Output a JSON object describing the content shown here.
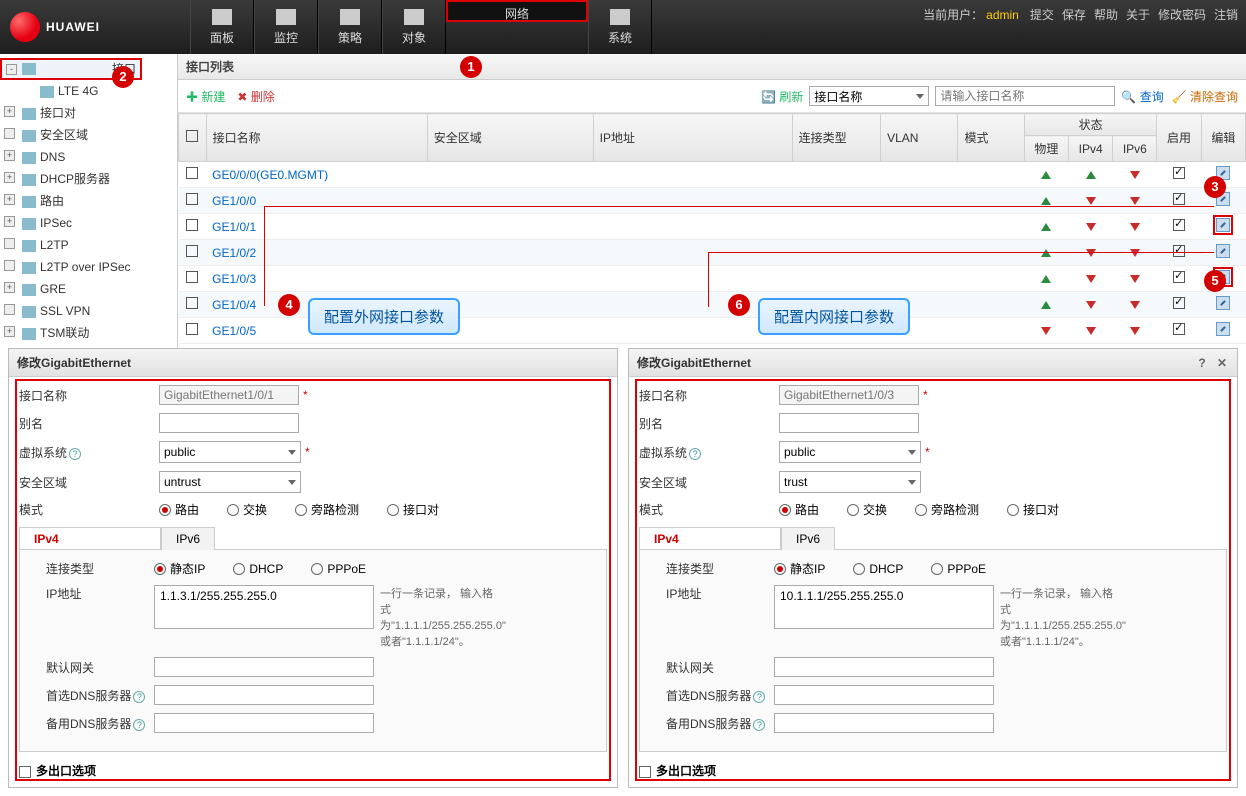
{
  "topnav": {
    "tabs": [
      "面板",
      "监控",
      "策略",
      "对象",
      "网络",
      "系统"
    ],
    "selected": 4,
    "user_label": "当前用户：",
    "user": "admin",
    "links": [
      "提交",
      "保存",
      "帮助",
      "关于",
      "修改密码",
      "注销"
    ]
  },
  "tree": {
    "items": [
      {
        "label": "接口",
        "expand": "-",
        "sel": true
      },
      {
        "label": "LTE 4G",
        "child": true
      },
      {
        "label": "接口对",
        "expand": "+"
      },
      {
        "label": "安全区域",
        "expand": ""
      },
      {
        "label": "DNS",
        "expand": "+"
      },
      {
        "label": "DHCP服务器",
        "expand": "+"
      },
      {
        "label": "路由",
        "expand": "+"
      },
      {
        "label": "IPSec",
        "expand": "+"
      },
      {
        "label": "L2TP",
        "expand": ""
      },
      {
        "label": "L2TP over IPSec",
        "expand": ""
      },
      {
        "label": "GRE",
        "expand": "+"
      },
      {
        "label": "SSL VPN",
        "expand": ""
      },
      {
        "label": "TSM联动",
        "expand": "+"
      }
    ]
  },
  "iface": {
    "title": "接口列表",
    "btn_new": "✚ 新建",
    "btn_del": "✖ 删除",
    "refresh": "刷新",
    "filter_field": "接口名称",
    "filter_ph": "请输入接口名称",
    "search": "查询",
    "clear": "清除查询",
    "cols": {
      "name": "接口名称",
      "zone": "安全区域",
      "ip": "IP地址",
      "conn": "连接类型",
      "vlan": "VLAN",
      "mode": "模式",
      "status": "状态",
      "phy": "物理",
      "ipv4": "IPv4",
      "ipv6": "IPv6",
      "enable": "启用",
      "edit": "编辑"
    },
    "rows": [
      {
        "name": "GE0/0/0(GE0.MGMT)",
        "phy": "up",
        "v4": "up",
        "v6": "dn",
        "en": true
      },
      {
        "name": "GE1/0/0",
        "phy": "up",
        "v4": "dn",
        "v6": "dn",
        "en": true
      },
      {
        "name": "GE1/0/1",
        "phy": "up",
        "v4": "dn",
        "v6": "dn",
        "en": true
      },
      {
        "name": "GE1/0/2",
        "phy": "up",
        "v4": "dn",
        "v6": "dn",
        "en": true
      },
      {
        "name": "GE1/0/3",
        "phy": "up",
        "v4": "dn",
        "v6": "dn",
        "en": true
      },
      {
        "name": "GE1/0/4",
        "phy": "up",
        "v4": "dn",
        "v6": "dn",
        "en": true
      },
      {
        "name": "GE1/0/5",
        "phy": "dn",
        "v4": "dn",
        "v6": "dn",
        "en": true
      }
    ]
  },
  "callouts": {
    "c4": "配置外网接口参数",
    "c6": "配置内网接口参数"
  },
  "dlg": {
    "title": "修改GigabitEthernet",
    "lbl_name": "接口名称",
    "lbl_alias": "别名",
    "lbl_vsys": "虚拟系统",
    "lbl_zone": "安全区域",
    "lbl_mode": "模式",
    "modes": [
      "路由",
      "交换",
      "旁路检测",
      "接口对"
    ],
    "tab_v4": "IPv4",
    "tab_v6": "IPv6",
    "lbl_conn": "连接类型",
    "conns": [
      "静态IP",
      "DHCP",
      "PPPoE"
    ],
    "lbl_ip": "IP地址",
    "hint_ip": "一行一条记录，\n输入格式为\"1.1.1.1/255.255.255.0\"\n或者\"1.1.1.1/24\"。",
    "lbl_gw": "默认网关",
    "lbl_dns1": "首选DNS服务器",
    "lbl_dns2": "备用DNS服务器",
    "lbl_multi": "多出口选项",
    "left": {
      "name": "GigabitEthernet1/0/1",
      "vsys": "public",
      "zone": "untrust",
      "ip": "1.1.3.1/255.255.255.0"
    },
    "right": {
      "name": "GigabitEthernet1/0/3",
      "vsys": "public",
      "zone": "trust",
      "ip": "10.1.1.1/255.255.255.0"
    }
  }
}
